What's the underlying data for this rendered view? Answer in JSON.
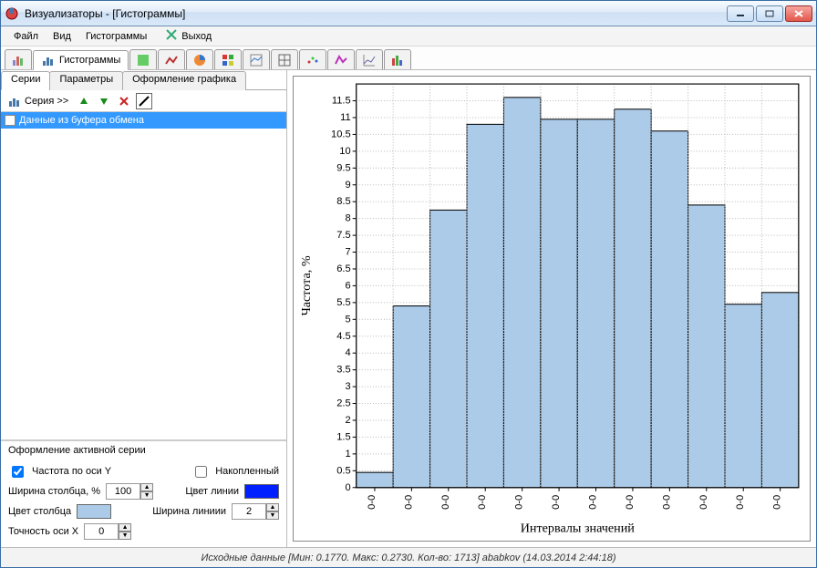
{
  "title": "Визуализаторы - [Гистограммы]",
  "menu": {
    "file": "Файл",
    "view": "Вид",
    "hist": "Гистограммы",
    "exit": "Выход"
  },
  "viewTabs": {
    "activeLabel": "Гистограммы"
  },
  "innerTabs": [
    "Серии",
    "Параметры",
    "Оформление графика"
  ],
  "seriesToolbar": {
    "seriesBtn": "Серия >>"
  },
  "seriesList": {
    "item0": {
      "label": "Данные из буфера обмена",
      "selected": true
    }
  },
  "form": {
    "title": "Оформление активной серии",
    "freqY": "Частота по оси Y",
    "accum": "Накопленный",
    "barWidth": "Ширина столбца, %",
    "barWidthVal": "100",
    "lineColor": "Цвет линии",
    "barColor": "Цвет столбца",
    "lineWidth": "Ширина линиии",
    "lineWidthVal": "2",
    "precX": "Точность оси X",
    "precXVal": "0",
    "barFill": "#accbe8",
    "lineFill": "#0020ff"
  },
  "status": "Исходные данные [Мин: 0.1770. Макс: 0.2730. Кол-во: 1713] ababkov (14.03.2014 2:44:18)",
  "chart_data": {
    "type": "bar",
    "ylabel": "Частота, %",
    "xlabel": "Интервалы значений",
    "ylim": [
      0,
      12
    ],
    "yticks": [
      0,
      0.5,
      1,
      1.5,
      2,
      2.5,
      3,
      3.5,
      4,
      4.5,
      5,
      5.5,
      6,
      6.5,
      7,
      7.5,
      8,
      8.5,
      9,
      9.5,
      10,
      10.5,
      11,
      11.5
    ],
    "ytickLabels": [
      "0",
      "0.5",
      "1",
      "1.5",
      "2",
      "2.5",
      "3",
      "3.5",
      "4",
      "4.5",
      "5",
      "5.5",
      "6",
      "6.5",
      "7",
      "7.5",
      "8",
      "8.5",
      "9",
      "9.5",
      "10",
      "10.5",
      "11",
      "11.5"
    ],
    "categories": [
      "0-0",
      "0-0",
      "0-0",
      "0-0",
      "0-0",
      "0-0",
      "0-0",
      "0-0",
      "0-0",
      "0-0",
      "0-0",
      "0-0"
    ],
    "values": [
      0.45,
      5.4,
      8.25,
      10.8,
      11.6,
      10.95,
      10.95,
      11.25,
      10.6,
      8.4,
      5.45,
      5.8
    ],
    "barFill": "#accbe8",
    "barStroke": "#000000"
  }
}
